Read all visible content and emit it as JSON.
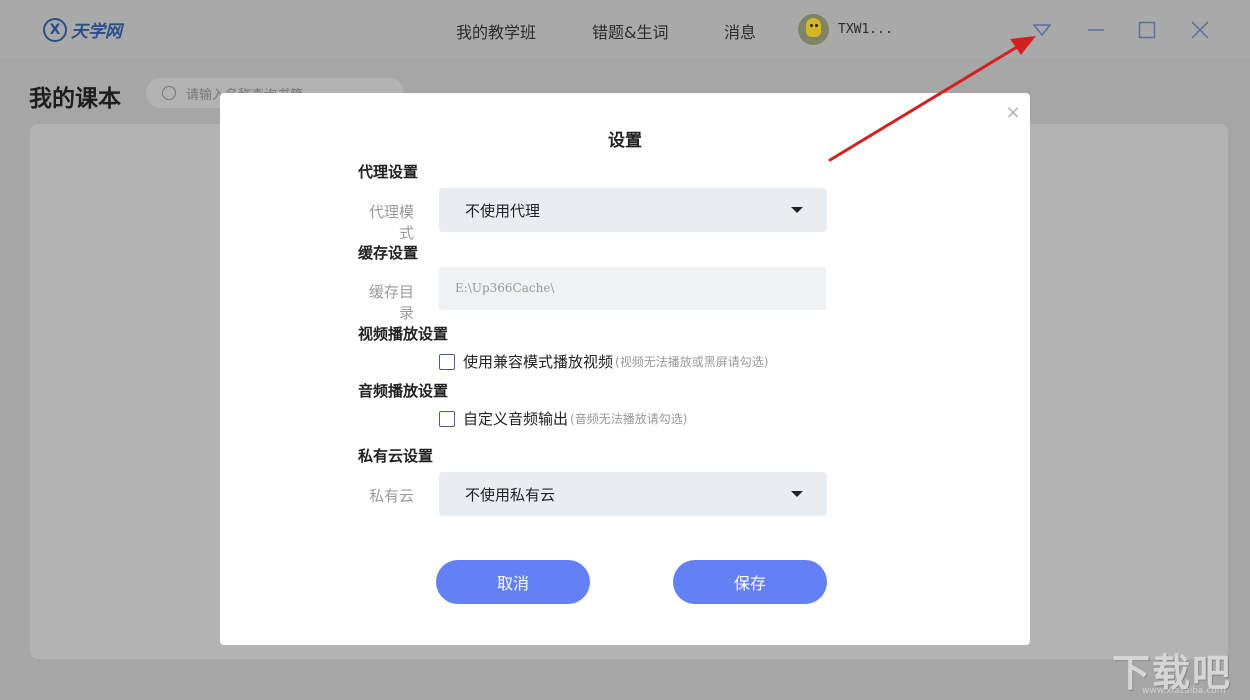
{
  "app": {
    "logo_text": "天学网",
    "nav": [
      "我的教学班",
      "错题&生词",
      "消息"
    ],
    "username": "TXW1...",
    "window_controls": [
      "dropdown-triangle-icon",
      "minimize-icon",
      "maximize-icon",
      "close-icon"
    ]
  },
  "page": {
    "title": "我的课本",
    "search_placeholder": "请输入名称查询书籍"
  },
  "dialog": {
    "title": "设置",
    "close_icon": "×",
    "proxy": {
      "section": "代理设置",
      "label": "代理模式",
      "value": "不使用代理"
    },
    "cache": {
      "section": "缓存设置",
      "label": "缓存目录",
      "value": "E:\\Up366Cache\\"
    },
    "video": {
      "section": "视频播放设置",
      "checkbox_label": "使用兼容模式播放视频",
      "hint": "(视频无法播放或黑屏请勾选)",
      "checked": false
    },
    "audio": {
      "section": "音频播放设置",
      "checkbox_label": "自定义音频输出",
      "hint": "(音频无法播放请勾选)",
      "checked": false
    },
    "cloud": {
      "section": "私有云设置",
      "label": "私有云",
      "value": "不使用私有云"
    },
    "cancel_label": "取消",
    "save_label": "保存"
  },
  "watermark": {
    "text": "下载吧",
    "url": "www.xiazaiba.com"
  },
  "colors": {
    "primary_button": "#6480f5",
    "annotation_arrow": "#d42020",
    "overlay": "#a6a6a6"
  }
}
